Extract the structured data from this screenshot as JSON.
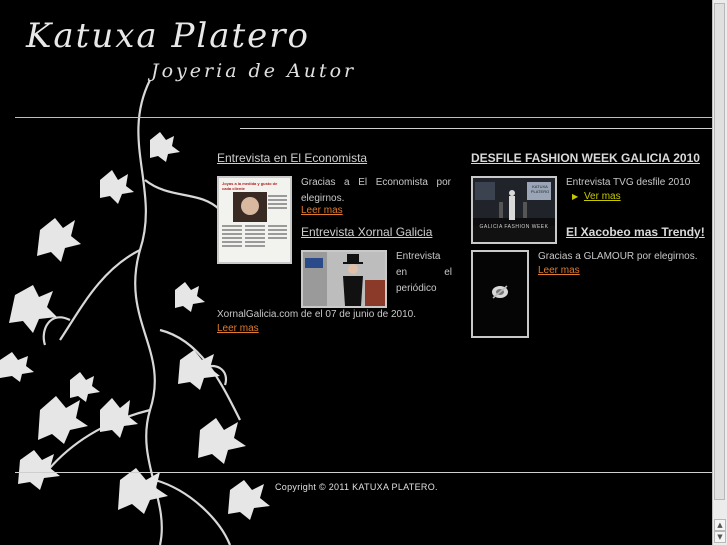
{
  "header": {
    "brand": "Katuxa Platero",
    "tagline": "Joyeria de Autor"
  },
  "news_left": {
    "item1": {
      "title": "Entrevista en El Economista",
      "text": "Gracias a El Economista por elegirnos.",
      "link": "Leer mas"
    },
    "item2": {
      "title": "Entrevista Xornal Galicia",
      "text_a": "Entrevista en el periódico",
      "text_b": "XornalGalicia.com de el 07 de junio de 2010.",
      "link": "Leer mas"
    }
  },
  "news_right": {
    "item1": {
      "title": "DESFILE FASHION WEEK GALICIA 2010",
      "text": "Entrevista TVG desfile 2010",
      "link": "Ver mas"
    },
    "item2": {
      "title": "El Xacobeo mas Trendy!",
      "text": "Gracias a GLAMOUR por elegirnos.",
      "link": "Leer mas"
    }
  },
  "thumb_texts": {
    "newspaper_headline": "Joyas a la medida y gusto de cada cliente",
    "runway_banner": "GALICIA FASHION WEEK",
    "runway_sign": "KATUXA PLATERO"
  },
  "footer": {
    "copyright": "Copyright © 2011 KATUXA PLATERO."
  },
  "colors": {
    "background": "#000000",
    "link": "#e07a2e",
    "text": "#c8c8c8"
  }
}
